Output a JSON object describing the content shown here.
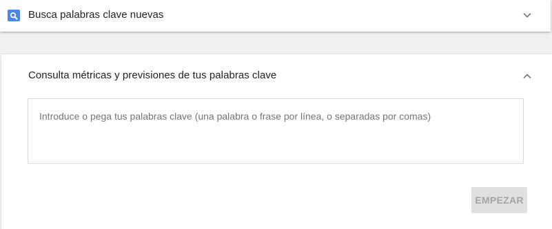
{
  "discover_card": {
    "title": "Busca palabras clave nuevas",
    "icon": "search-icon",
    "chevron": "chevron-down-icon",
    "accent_color": "#4a86e8"
  },
  "metrics_card": {
    "title": "Consulta métricas y previsiones de tus palabras clave",
    "chevron": "chevron-up-icon",
    "keywords_input": {
      "value": "",
      "placeholder": "Introduce o pega tus palabras clave (una palabra o frase por línea, o separadas por comas)"
    },
    "start_button": {
      "label": "EMPEZAR",
      "state": "disabled"
    }
  }
}
